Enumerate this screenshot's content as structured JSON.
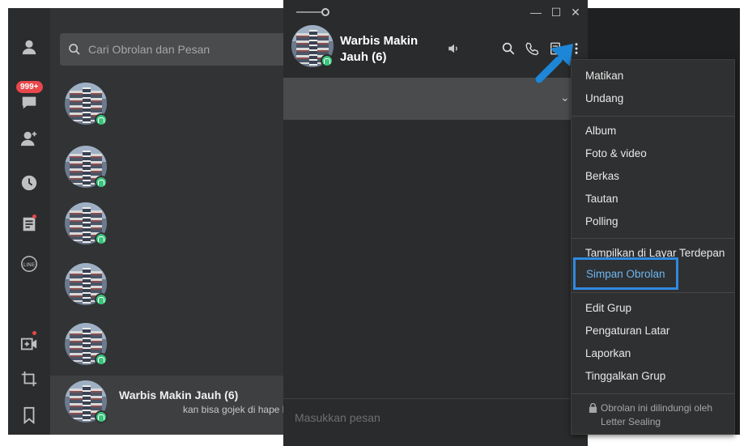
{
  "rail": {
    "items": [
      "profile-icon",
      "chats-icon",
      "add-friend-icon",
      "history-icon",
      "notes-icon",
      "line-icon",
      "video-call-icon",
      "crop-icon",
      "bookmark-icon"
    ],
    "unread_badge": "999+"
  },
  "chat_list": {
    "search_placeholder": "Cari Obrolan dan Pesan",
    "rows": [
      {
        "title": "",
        "message": ""
      },
      {
        "title": "",
        "message": ""
      },
      {
        "title": "",
        "message": ""
      },
      {
        "title": "",
        "message": ""
      },
      {
        "title": "",
        "message": ""
      },
      {
        "title": "Warbis Makin Jauh (6)",
        "message": "kan bisa gojek di hape l"
      }
    ]
  },
  "chat": {
    "name": "Warbis Makin Jauh (6)",
    "composer_placeholder": "Masukkan pesan",
    "window_buttons": {
      "minimize": "—",
      "maximize": "☐",
      "close": "✕"
    },
    "notice_chevron": "⌄"
  },
  "menu": {
    "groups": [
      [
        "Matikan",
        "Undang"
      ],
      [
        "Album",
        "Foto & video",
        "Berkas",
        "Tautan",
        "Polling"
      ],
      [
        "Tampilkan di Layar Terdepan",
        "Simpan Obrolan"
      ],
      [
        "Edit Grup",
        "Pengaturan Latar",
        "Laporkan",
        "Tinggalkan Grup"
      ]
    ],
    "highlighted": "Simpan Obrolan",
    "footer": "Obrolan ini dilindungi oleh Letter Sealing"
  },
  "colors": {
    "accent": "#2f8ae0",
    "badge": "#e8474b",
    "group_badge": "#3ac47d"
  }
}
